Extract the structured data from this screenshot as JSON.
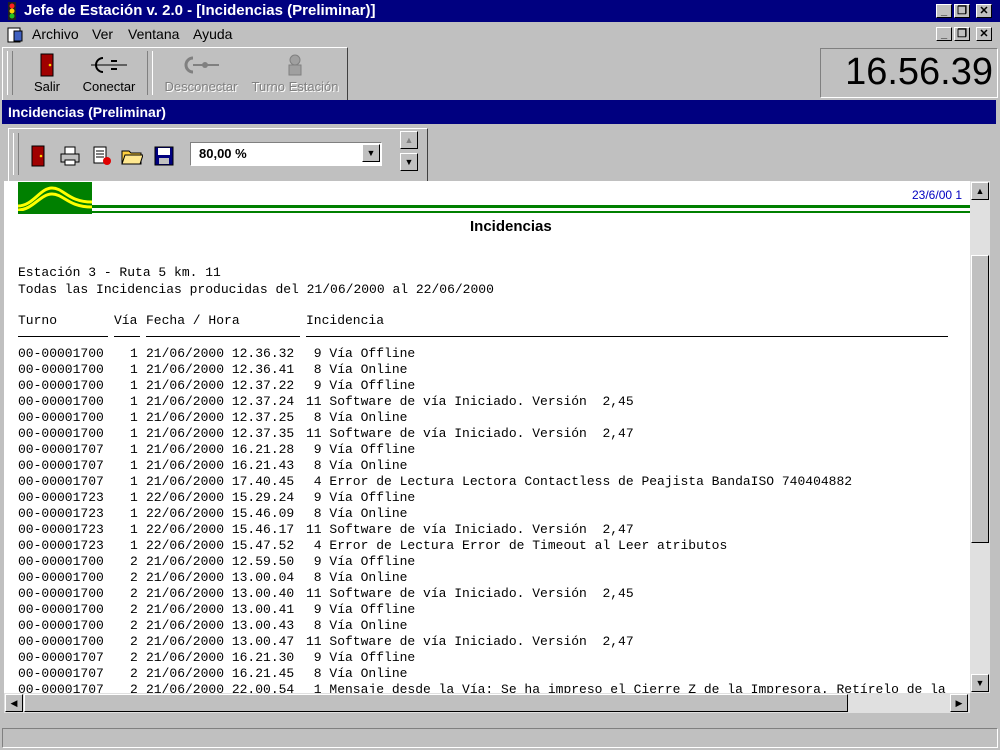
{
  "app": {
    "title": "Jefe de Estación v. 2.0 - [Incidencias (Preliminar)]"
  },
  "menu": {
    "items": [
      "Archivo",
      "Ver",
      "Ventana",
      "Ayuda"
    ]
  },
  "toolbar": {
    "buttons": [
      {
        "label": "Salir",
        "enabled": true
      },
      {
        "label": "Conectar",
        "enabled": true
      },
      {
        "label": "Desconectar",
        "enabled": false
      },
      {
        "label": "Turno Estación",
        "enabled": false
      }
    ]
  },
  "clock": "16.56.39",
  "child": {
    "title": "Incidencias (Preliminar)",
    "zoom_value": "80,00 %"
  },
  "report": {
    "date": "23/6/00 1",
    "title": "Incidencias",
    "station": "Estación 3 - Ruta 5 km. 11",
    "range": "Todas las Incidencias producidas del 21/06/2000 al 22/06/2000",
    "columns": [
      "Turno",
      "Vía",
      "Fecha / Hora",
      "Incidencia"
    ],
    "rows": [
      [
        "00-00001700",
        "1",
        "21/06/2000 12.36.32",
        " 9 Vía Offline"
      ],
      [
        "00-00001700",
        "1",
        "21/06/2000 12.36.41",
        " 8 Vía Online"
      ],
      [
        "00-00001700",
        "1",
        "21/06/2000 12.37.22",
        " 9 Vía Offline"
      ],
      [
        "00-00001700",
        "1",
        "21/06/2000 12.37.24",
        "11 Software de vía Iniciado. Versión  2,45"
      ],
      [
        "00-00001700",
        "1",
        "21/06/2000 12.37.25",
        " 8 Vía Online"
      ],
      [
        "00-00001700",
        "1",
        "21/06/2000 12.37.35",
        "11 Software de vía Iniciado. Versión  2,47"
      ],
      [
        "00-00001707",
        "1",
        "21/06/2000 16.21.28",
        " 9 Vía Offline"
      ],
      [
        "00-00001707",
        "1",
        "21/06/2000 16.21.43",
        " 8 Vía Online"
      ],
      [
        "00-00001707",
        "1",
        "21/06/2000 17.40.45",
        " 4 Error de Lectura Lectora Contactless de Peajista BandaISO 740404882"
      ],
      [
        "00-00001723",
        "1",
        "22/06/2000 15.29.24",
        " 9 Vía Offline"
      ],
      [
        "00-00001723",
        "1",
        "22/06/2000 15.46.09",
        " 8 Vía Online"
      ],
      [
        "00-00001723",
        "1",
        "22/06/2000 15.46.17",
        "11 Software de vía Iniciado. Versión  2,47"
      ],
      [
        "00-00001723",
        "1",
        "22/06/2000 15.47.52",
        " 4 Error de Lectura Error de Timeout al Leer atributos"
      ],
      [
        "00-00001700",
        "2",
        "21/06/2000 12.59.50",
        " 9 Vía Offline"
      ],
      [
        "00-00001700",
        "2",
        "21/06/2000 13.00.04",
        " 8 Vía Online"
      ],
      [
        "00-00001700",
        "2",
        "21/06/2000 13.00.40",
        "11 Software de vía Iniciado. Versión  2,45"
      ],
      [
        "00-00001700",
        "2",
        "21/06/2000 13.00.41",
        " 9 Vía Offline"
      ],
      [
        "00-00001700",
        "2",
        "21/06/2000 13.00.43",
        " 8 Vía Online"
      ],
      [
        "00-00001700",
        "2",
        "21/06/2000 13.00.47",
        "11 Software de vía Iniciado. Versión  2,47"
      ],
      [
        "00-00001707",
        "2",
        "21/06/2000 16.21.30",
        " 9 Vía Offline"
      ],
      [
        "00-00001707",
        "2",
        "21/06/2000 16.21.45",
        " 8 Vía Online"
      ],
      [
        "00-00001707",
        "2",
        "21/06/2000 22.00.54",
        " 1 Mensaje desde la Vía: Se ha impreso el Cierre Z de la Impresora. Retírelo de la"
      ]
    ]
  },
  "colors": {
    "titlebar": "#000080",
    "logo_green": "#008000",
    "logo_yellow": "#ffff00",
    "date_blue": "#0000c0"
  }
}
